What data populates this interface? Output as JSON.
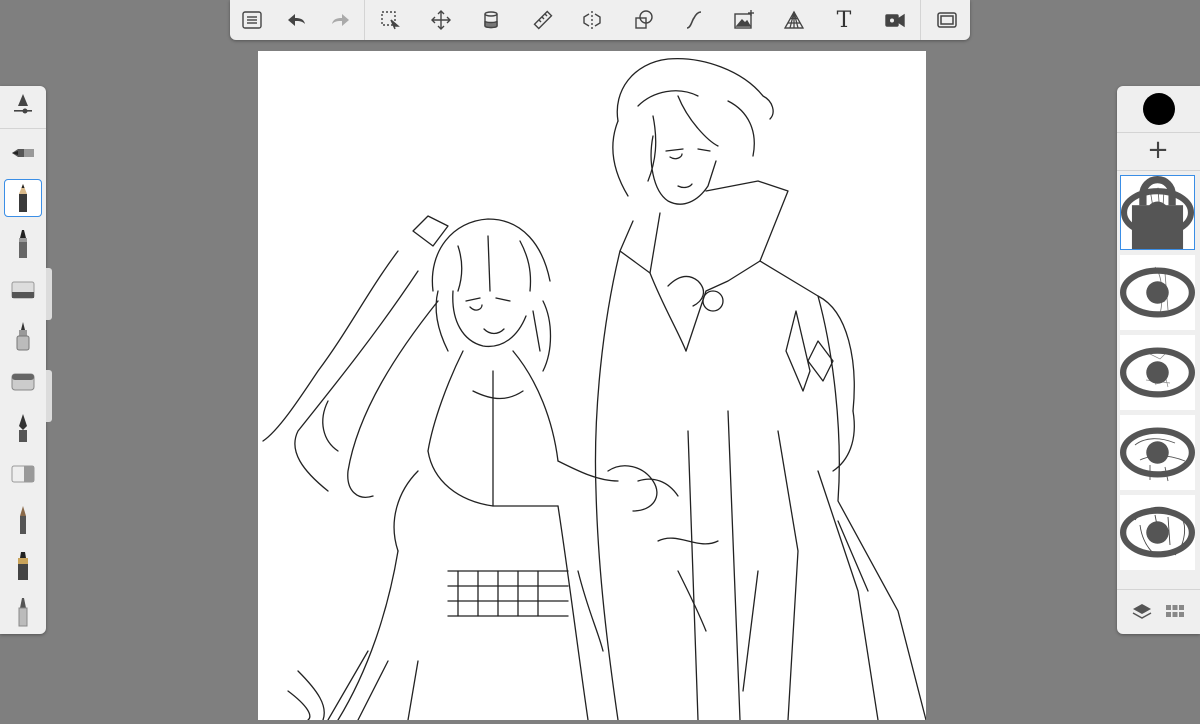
{
  "toolbar": {
    "items": [
      {
        "name": "list-icon"
      },
      {
        "name": "undo-icon"
      },
      {
        "name": "redo-icon"
      },
      {
        "name": "selection-icon"
      },
      {
        "name": "transform-icon"
      },
      {
        "name": "fill-bucket-icon"
      },
      {
        "name": "ruler-icon"
      },
      {
        "name": "symmetry-icon"
      },
      {
        "name": "shapes-icon"
      },
      {
        "name": "curve-icon"
      },
      {
        "name": "add-image-icon"
      },
      {
        "name": "perspective-grid-icon"
      },
      {
        "name": "text-icon",
        "label": "T"
      },
      {
        "name": "record-icon"
      },
      {
        "name": "fullscreen-icon"
      }
    ]
  },
  "brushes": [
    {
      "name": "brush-settings-icon"
    },
    {
      "name": "fountain-pen-icon"
    },
    {
      "name": "pencil-icon",
      "selected": true
    },
    {
      "name": "marker-icon"
    },
    {
      "name": "eraser-icon"
    },
    {
      "name": "airbrush-icon"
    },
    {
      "name": "smudge-icon"
    },
    {
      "name": "ink-pen-icon"
    },
    {
      "name": "soft-eraser-icon"
    },
    {
      "name": "fine-liner-icon"
    },
    {
      "name": "brush-pen-icon"
    },
    {
      "name": "paint-brush-icon"
    }
  ],
  "colors": {
    "current_color": "#000000",
    "selection_accent": "#3a8ee6",
    "panel_bg": "#efefef",
    "workspace_bg": "#7f7f7f"
  },
  "layers": {
    "add_label": "+",
    "items": [
      {
        "name": "layer-1",
        "visible": true,
        "selected": true,
        "locked": true
      },
      {
        "name": "layer-2",
        "visible": true
      },
      {
        "name": "layer-3",
        "visible": true
      },
      {
        "name": "layer-4",
        "visible": true
      },
      {
        "name": "layer-5",
        "visible": true
      }
    ]
  }
}
